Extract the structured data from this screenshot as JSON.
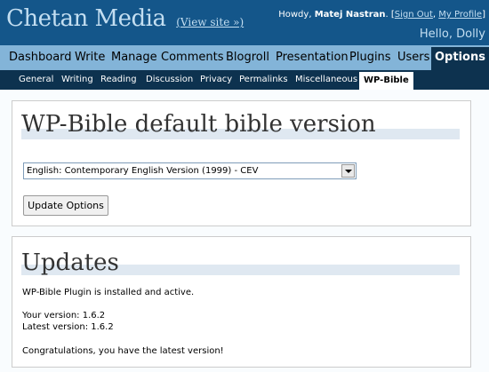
{
  "header": {
    "site_title": "Chetan Media",
    "view_site": "(View site »)",
    "howdy": "Howdy,",
    "username": "Matej Nastran",
    "sign_out": "Sign Out",
    "my_profile": "My Profile",
    "greeting": "Hello, Dolly"
  },
  "menu": {
    "items": [
      "Dashboard",
      "Write",
      "Manage",
      "Comments",
      "Blogroll",
      "Presentation",
      "Plugins",
      "Users",
      "Options"
    ],
    "active": "Options"
  },
  "submenu": {
    "items": [
      "General",
      "Writing",
      "Reading",
      "Discussion",
      "Privacy",
      "Permalinks",
      "Miscellaneous",
      "WP-Bible"
    ],
    "active": "WP-Bible"
  },
  "options_panel": {
    "heading": "WP-Bible default bible version",
    "select_value": "English: Contemporary English Version (1999) - CEV",
    "button_label": "Update Options"
  },
  "updates_panel": {
    "heading": "Updates",
    "status": "WP-Bible Plugin is installed and active.",
    "your_version": "Your version: 1.6.2",
    "latest_version": "Latest version: 1.6.2",
    "message": "Congratulations, you have the latest version!"
  },
  "colors": {
    "header_bg": "#14568a",
    "menu_bg": "#83b4d8",
    "submenu_bg": "#0d324f",
    "heading_rule": "#dfe8f1"
  }
}
